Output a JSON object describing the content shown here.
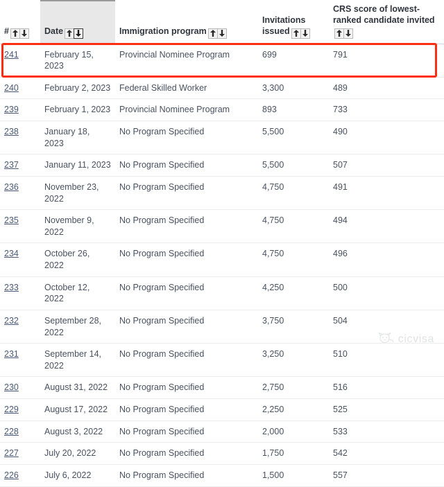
{
  "table": {
    "columns": [
      {
        "key": "num",
        "label": "#",
        "sortable": true,
        "sorted": false,
        "sort_dir": ""
      },
      {
        "key": "date",
        "label": "Date",
        "sortable": true,
        "sorted": true,
        "sort_dir": "desc"
      },
      {
        "key": "prog",
        "label": "Immigration program",
        "sortable": true,
        "sorted": false,
        "sort_dir": ""
      },
      {
        "key": "inv",
        "label": "Invitations issued",
        "sortable": true,
        "sorted": false,
        "sort_dir": ""
      },
      {
        "key": "crs",
        "label": "CRS score of lowest-ranked candidate invited",
        "sortable": true,
        "sorted": false,
        "sort_dir": ""
      }
    ],
    "sort_icons": {
      "asc": "sort-ascending-icon",
      "desc": "sort-descending-icon"
    },
    "rows": [
      {
        "num": "241",
        "date": "February 15, 2023",
        "prog": "Provincial Nominee Program",
        "inv": "699",
        "crs": "791",
        "highlighted": true
      },
      {
        "num": "240",
        "date": "February 2, 2023",
        "prog": "Federal Skilled Worker",
        "inv": "3,300",
        "crs": "489",
        "highlighted": false
      },
      {
        "num": "239",
        "date": "February 1, 2023",
        "prog": "Provincial Nominee Program",
        "inv": "893",
        "crs": "733",
        "highlighted": false
      },
      {
        "num": "238",
        "date": "January 18, 2023",
        "prog": "No Program Specified",
        "inv": "5,500",
        "crs": "490",
        "highlighted": false
      },
      {
        "num": "237",
        "date": "January 11, 2023",
        "prog": "No Program Specified",
        "inv": "5,500",
        "crs": "507",
        "highlighted": false
      },
      {
        "num": "236",
        "date": "November 23, 2022",
        "prog": "No Program Specified",
        "inv": "4,750",
        "crs": "491",
        "highlighted": false
      },
      {
        "num": "235",
        "date": "November 9, 2022",
        "prog": "No Program Specified",
        "inv": "4,750",
        "crs": "494",
        "highlighted": false
      },
      {
        "num": "234",
        "date": "October 26, 2022",
        "prog": "No Program Specified",
        "inv": "4,750",
        "crs": "496",
        "highlighted": false
      },
      {
        "num": "233",
        "date": "October 12, 2022",
        "prog": "No Program Specified",
        "inv": "4,250",
        "crs": "500",
        "highlighted": false
      },
      {
        "num": "232",
        "date": "September 28, 2022",
        "prog": "No Program Specified",
        "inv": "3,750",
        "crs": "504",
        "highlighted": false
      },
      {
        "num": "231",
        "date": "September 14, 2022",
        "prog": "No Program Specified",
        "inv": "3,250",
        "crs": "510",
        "highlighted": false
      },
      {
        "num": "230",
        "date": "August 31, 2022",
        "prog": "No Program Specified",
        "inv": "2,750",
        "crs": "516",
        "highlighted": false
      },
      {
        "num": "229",
        "date": "August 17, 2022",
        "prog": "No Program Specified",
        "inv": "2,250",
        "crs": "525",
        "highlighted": false
      },
      {
        "num": "228",
        "date": "August 3, 2022",
        "prog": "No Program Specified",
        "inv": "2,000",
        "crs": "533",
        "highlighted": false
      },
      {
        "num": "227",
        "date": "July 20, 2022",
        "prog": "No Program Specified",
        "inv": "1,750",
        "crs": "542",
        "highlighted": false
      },
      {
        "num": "226",
        "date": "July 6, 2022",
        "prog": "No Program Specified",
        "inv": "1,500",
        "crs": "557",
        "highlighted": false
      }
    ]
  },
  "annotation": {
    "highlight_color": "#fb2d12",
    "highlight_target_row": "241"
  },
  "watermark": {
    "text": "cicvisa",
    "icon": "cat-face-logo-icon",
    "color": "#9aa0a8"
  }
}
